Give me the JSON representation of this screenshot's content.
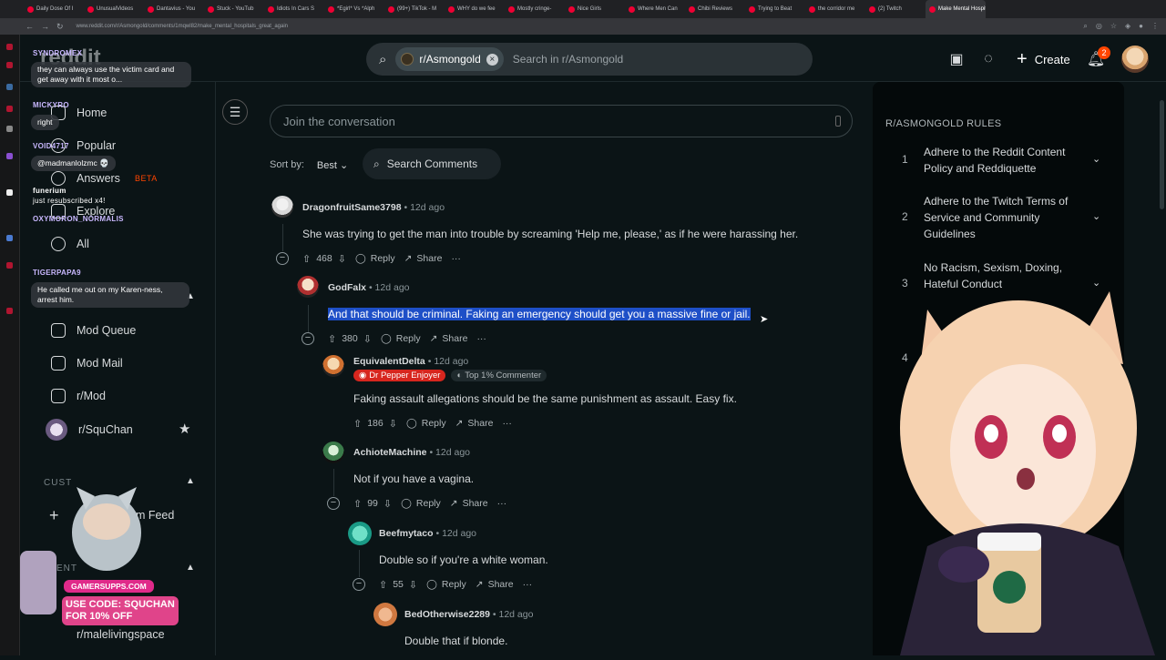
{
  "browser": {
    "tabs": [
      "Daily Dose Of I",
      "UnusualVideos",
      "Dantavius - You",
      "Stuck - YouTub",
      "Idiots In Cars S",
      "*Egirl* Vs *Alph",
      "(99+) TikTok - M",
      "WHY do we fee",
      "Mostly cringe-",
      "Nice Girls",
      "Where Men Can",
      "Chibi Reviews",
      "Trying to Beat",
      "the corridor me",
      "(2) Twitch",
      "Make Mental Hospitals G"
    ],
    "url": "www.reddit.com/r/Asmongold/comments/1mqwl82/make_mental_hospitals_great_again"
  },
  "header": {
    "logo_text": "reddit",
    "search_chip": "r/Asmongold",
    "search_placeholder": "Search in r/Asmongold",
    "create_label": "Create",
    "notif_count": "2"
  },
  "sidebar": {
    "nav": [
      {
        "label": "Home"
      },
      {
        "label": "Popular"
      },
      {
        "label": "Answers",
        "badge": "BETA"
      },
      {
        "label": "Explore"
      },
      {
        "label": "All"
      }
    ],
    "mod_items": [
      {
        "label": "Mod Queue"
      },
      {
        "label": "Mod Mail"
      },
      {
        "label": "r/Mod"
      }
    ],
    "community": "r/SquChan",
    "section_custom": "CUST",
    "custom_feed": "om Feed",
    "section_recent": "ENT",
    "recent_item": "r/malelivingspace"
  },
  "chat_overlay": [
    {
      "user": "SYNDROMEX",
      "msg": "they can always use the victim card and get away with it most o..."
    },
    {
      "user": "MICKYRO",
      "msg": "right"
    },
    {
      "user": "VOID4717",
      "msg": "@madmanlolzmc 💀"
    },
    {
      "user": "funerium",
      "msg": "just resubscribed x4!"
    },
    {
      "user": "OXYMORON_NORMALIS",
      "msg": ""
    },
    {
      "user": "TIGERPAPA9",
      "msg": "He called me out on my Karen-ness, arrest him."
    }
  ],
  "promo": {
    "site": "GAMERSUPPS.COM",
    "line1": "USE CODE: SQUCHAN",
    "line2": "FOR 10% OFF"
  },
  "main": {
    "join_placeholder": "Join the conversation",
    "sort_label": "Sort by:",
    "sort_value": "Best",
    "search_comments": "Search Comments"
  },
  "comments": [
    {
      "user": "DragonfruitSame3798",
      "time": "12d ago",
      "text": "She was trying to get the man into trouble by screaming 'Help me, please,' as if he were harassing her.",
      "votes": "468"
    },
    {
      "user": "GodFalx",
      "time": "12d ago",
      "text": "And that should be criminal. Faking an emergency should get you a massive fine or jail.",
      "votes": "380"
    },
    {
      "user": "EquivalentDelta",
      "time": "12d ago",
      "flair1": "Dr Pepper Enjoyer",
      "flair2": "Top 1% Commenter",
      "text": "Faking assault allegations should be the same punishment as assault. Easy fix.",
      "votes": "186"
    },
    {
      "user": "AchioteMachine",
      "time": "12d ago",
      "text": "Not if you have a vagina.",
      "votes": "99"
    },
    {
      "user": "Beefmytaco",
      "time": "12d ago",
      "text": "Double so if you're a white woman.",
      "votes": "55"
    },
    {
      "user": "BedOtherwise2289",
      "time": "12d ago",
      "text": "Double that if blonde.",
      "votes": ""
    }
  ],
  "actions": {
    "reply": "Reply",
    "share": "Share",
    "more": "···",
    "sep": "•"
  },
  "rules": {
    "title": "R/ASMONGOLD RULES",
    "items": [
      {
        "num": "1",
        "text": "Adhere to the Reddit Content Policy and Reddiquette"
      },
      {
        "num": "2",
        "text": "Adhere to the Twitch Terms of Service and Community Guidelines"
      },
      {
        "num": "3",
        "text": "No Racism, Sexism, Doxing, Hateful Conduct"
      },
      {
        "num": "4",
        "text": ""
      },
      {
        "num": "5",
        "text": ""
      }
    ]
  },
  "colors": {
    "accent": "#ff4500",
    "bg": "#0b1416",
    "highlight": "#1e4fc7",
    "flair_red": "#d7261e"
  }
}
